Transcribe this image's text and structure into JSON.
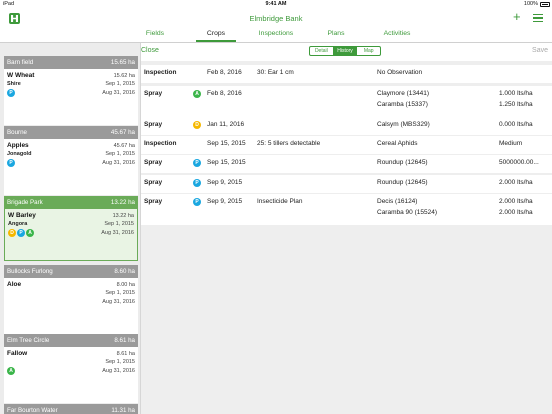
{
  "status": {
    "device": "iPad",
    "time": "9:41 AM",
    "battery": "100%"
  },
  "farm_title": "Elmbridge Bank",
  "tabs": [
    {
      "label": "Fields"
    },
    {
      "label": "Crops"
    },
    {
      "label": "Inspections"
    },
    {
      "label": "Plans"
    },
    {
      "label": "Activities"
    }
  ],
  "active_tab": "Crops",
  "toolbar": {
    "close_label": "Close",
    "save_label": "Save",
    "segments": [
      "Detail",
      "History",
      "Map"
    ],
    "active_segment": "History"
  },
  "fields": [
    {
      "name": "Barn field",
      "area": "15.65 ha",
      "crop": "W Wheat",
      "variety": "Shire",
      "crop_area": "15.62 ha",
      "start": "Sep 1, 2015",
      "end": "Aug 31, 2016",
      "badges": [
        "P"
      ]
    },
    {
      "name": "Bourne",
      "area": "45.67 ha",
      "crop": "Apples",
      "variety": "Jonagold",
      "crop_area": "45.67 ha",
      "start": "Sep 1, 2015",
      "end": "Aug 31, 2016",
      "badges": [
        "P"
      ]
    },
    {
      "name": "Brigade Park",
      "area": "13.22 ha",
      "crop": "W Barley",
      "variety": "Angora",
      "crop_area": "13.22 ha",
      "start": "Sep 1, 2015",
      "end": "Aug 31, 2016",
      "badges": [
        "D",
        "P",
        "A"
      ],
      "selected": true
    },
    {
      "name": "Bullocks Furlong",
      "area": "8.60 ha",
      "crop": "Aloe",
      "variety": "",
      "crop_area": "8.00 ha",
      "start": "Sep 1, 2015",
      "end": "Aug 31, 2016",
      "badges": []
    },
    {
      "name": "Elm Tree Circle",
      "area": "8.61 ha",
      "crop": "Fallow",
      "variety": "",
      "crop_area": "8.61 ha",
      "start": "Sep 1, 2015",
      "end": "Aug 31, 2016",
      "badges": [
        "A"
      ]
    },
    {
      "name": "Far Bourton Water",
      "area": "11.31 ha"
    }
  ],
  "history": [
    {
      "type": "Inspection",
      "badge": "",
      "date": "Feb 8, 2016",
      "note": "30: Ear 1 cm",
      "products": [
        "No Observation"
      ],
      "rates": [
        ""
      ]
    },
    {
      "type": "Spray",
      "badge": "A",
      "date": "Feb 8, 2016",
      "note": "",
      "products": [
        "Claymore (13441)",
        "Caramba (15337)"
      ],
      "rates": [
        "1.000 lts/ha",
        "1.250 lts/ha"
      ]
    },
    {
      "type": "Spray",
      "badge": "D",
      "date": "Jan 11, 2016",
      "note": "",
      "products": [
        "Calsym (MBS329)"
      ],
      "rates": [
        "0.000 lts/ha"
      ]
    },
    {
      "type": "Inspection",
      "badge": "",
      "date": "Sep 15, 2015",
      "note": "25: 5 tillers detectable",
      "products": [
        "Cereal Aphids"
      ],
      "rates": [
        "Medium"
      ]
    },
    {
      "type": "Spray",
      "badge": "P",
      "date": "Sep 15, 2015",
      "note": "",
      "products": [
        "Roundup (12645)"
      ],
      "rates": [
        "5000000.00..."
      ]
    },
    {
      "type": "Spray",
      "badge": "P",
      "date": "Sep 9, 2015",
      "note": "",
      "products": [
        "Roundup (12645)"
      ],
      "rates": [
        "2.000 lts/ha"
      ]
    },
    {
      "type": "Spray",
      "badge": "P",
      "date": "Sep 9, 2015",
      "note": "Insecticide Plan",
      "products": [
        "Decis (16124)",
        "Caramba 90 (15524)"
      ],
      "rates": [
        "2.000 lts/ha",
        "2.000 lts/ha"
      ]
    }
  ],
  "colors": {
    "accent": "#3e9a3b",
    "badge_P": "#1aa7e0",
    "badge_A": "#3bb54a",
    "badge_D": "#f5b800",
    "field_header": "#9a9a9a",
    "field_header_selected": "#6aab58"
  }
}
